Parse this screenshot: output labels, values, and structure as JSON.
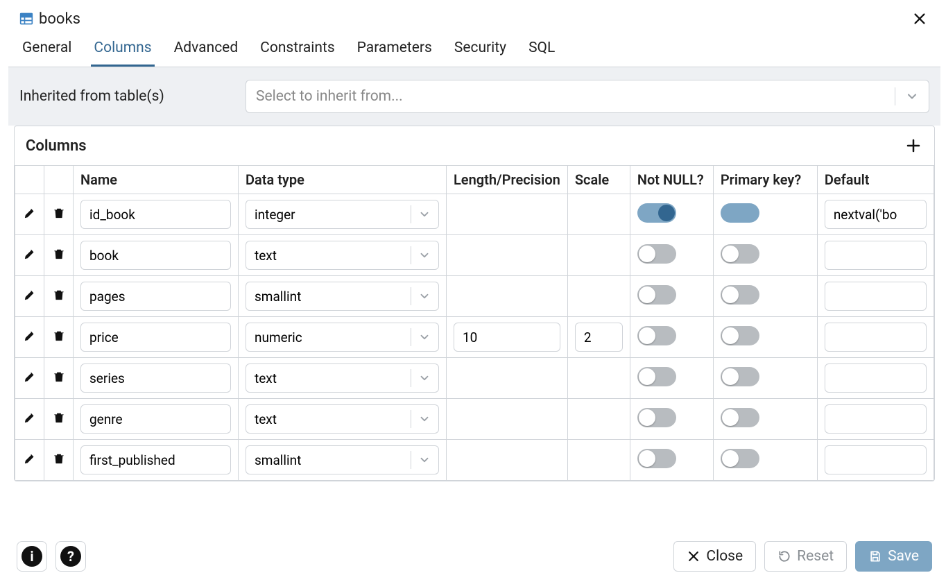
{
  "header": {
    "title": "books"
  },
  "tabs": [
    {
      "label": "General",
      "active": false
    },
    {
      "label": "Columns",
      "active": true
    },
    {
      "label": "Advanced",
      "active": false
    },
    {
      "label": "Constraints",
      "active": false
    },
    {
      "label": "Parameters",
      "active": false
    },
    {
      "label": "Security",
      "active": false
    },
    {
      "label": "SQL",
      "active": false
    }
  ],
  "inherit": {
    "label": "Inherited from table(s)",
    "placeholder": "Select to inherit from..."
  },
  "columns_section": {
    "title": "Columns",
    "headers": {
      "name": "Name",
      "type": "Data type",
      "length": "Length/Precision",
      "scale": "Scale",
      "notnull": "Not NULL?",
      "pk": "Primary key?",
      "default": "Default"
    },
    "rows": [
      {
        "name": "id_book",
        "type": "integer",
        "length": "",
        "scale": "",
        "notnull": true,
        "pk": true,
        "pk_light": true,
        "default": "nextval('bo"
      },
      {
        "name": "book",
        "type": "text",
        "length": "",
        "scale": "",
        "notnull": false,
        "pk": false,
        "pk_light": false,
        "default": ""
      },
      {
        "name": "pages",
        "type": "smallint",
        "length": "",
        "scale": "",
        "notnull": false,
        "pk": false,
        "pk_light": false,
        "default": ""
      },
      {
        "name": "price",
        "type": "numeric",
        "length": "10",
        "scale": "2",
        "notnull": false,
        "pk": false,
        "pk_light": false,
        "default": ""
      },
      {
        "name": "series",
        "type": "text",
        "length": "",
        "scale": "",
        "notnull": false,
        "pk": false,
        "pk_light": false,
        "default": ""
      },
      {
        "name": "genre",
        "type": "text",
        "length": "",
        "scale": "",
        "notnull": false,
        "pk": false,
        "pk_light": false,
        "default": ""
      },
      {
        "name": "first_published",
        "type": "smallint",
        "length": "",
        "scale": "",
        "notnull": false,
        "pk": false,
        "pk_light": false,
        "default": ""
      }
    ]
  },
  "footer": {
    "close": "Close",
    "reset": "Reset",
    "save": "Save"
  }
}
